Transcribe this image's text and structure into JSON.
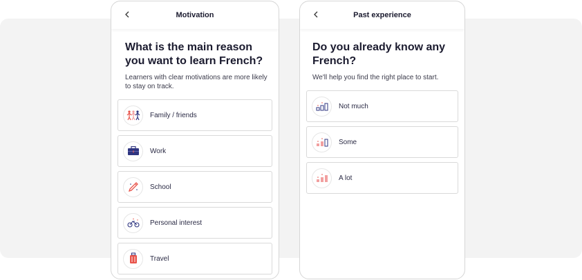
{
  "left": {
    "title": "Motivation",
    "question": "What is the main reason you want to learn French?",
    "subtitle": "Learners with clear motivations are more likely to stay on track.",
    "options": [
      {
        "label": "Family / friends",
        "icon": "family-icon"
      },
      {
        "label": "Work",
        "icon": "briefcase-icon"
      },
      {
        "label": "School",
        "icon": "pencil-icon"
      },
      {
        "label": "Personal interest",
        "icon": "bicycle-icon"
      },
      {
        "label": "Travel",
        "icon": "luggage-icon"
      }
    ]
  },
  "right": {
    "title": "Past experience",
    "question": "Do you already know any French?",
    "subtitle": "We'll help you find the right place to start.",
    "options": [
      {
        "label": "Not much",
        "icon": "level-low-icon"
      },
      {
        "label": "Some",
        "icon": "level-medium-icon"
      },
      {
        "label": "A lot",
        "icon": "level-high-icon"
      }
    ]
  },
  "colors": {
    "accent": "#e8534a",
    "navy": "#2f3580",
    "text": "#1b1b2f"
  }
}
